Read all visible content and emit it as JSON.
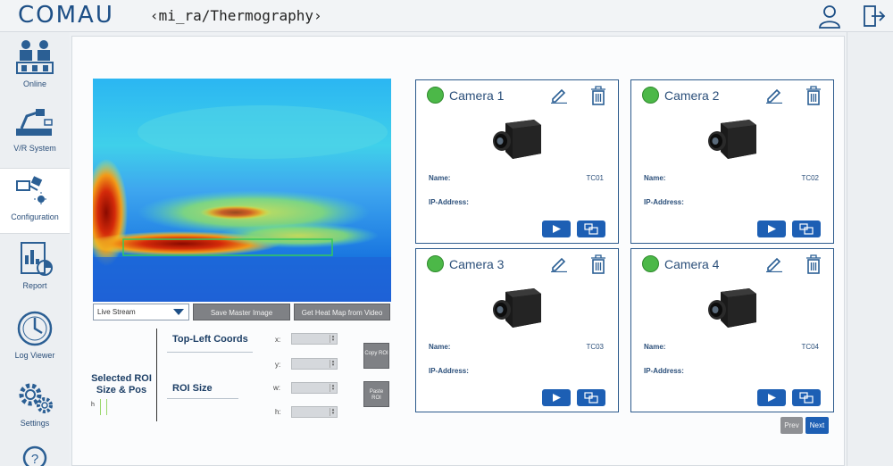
{
  "header": {
    "brand": "COMAU",
    "title": "‹mi_ra/Thermography›",
    "icons": [
      "user-icon",
      "logout-icon"
    ]
  },
  "sidebar": {
    "items": [
      {
        "label": "Online",
        "icon": "online-icon",
        "active": false
      },
      {
        "label": "V/R System",
        "icon": "robot-icon",
        "active": false
      },
      {
        "label": "Configuration",
        "icon": "configuration-icon",
        "active": true
      },
      {
        "label": "Report",
        "icon": "report-icon",
        "active": false
      },
      {
        "label": "Log Viewer",
        "icon": "clock-icon",
        "active": false
      },
      {
        "label": "Settings",
        "icon": "gear-icon",
        "active": false
      },
      {
        "label": "",
        "icon": "help-icon",
        "active": false
      }
    ]
  },
  "viewer": {
    "stream_select": "Live Stream",
    "save_master": "Save Master Image",
    "get_heatmap": "Get Heat Map from Video"
  },
  "roi": {
    "title": "Selected ROI Size & Pos",
    "top_left_label": "Top-Left Coords",
    "size_label": "ROI Size",
    "fields": {
      "x": "x:",
      "y": "y:",
      "w": "w:",
      "h": "h:"
    },
    "copy_btn": "Copy ROI",
    "paste_btn": "Paste ROI",
    "indicator": "h"
  },
  "cameras": [
    {
      "name": "Camera 1",
      "name_label": "Name:",
      "ip_label": "IP-Address:",
      "id": "TC01",
      "status": "online"
    },
    {
      "name": "Camera 2",
      "name_label": "Name:",
      "ip_label": "IP-Address:",
      "id": "TC02",
      "status": "online"
    },
    {
      "name": "Camera 3",
      "name_label": "Name:",
      "ip_label": "IP-Address:",
      "id": "TC03",
      "status": "online"
    },
    {
      "name": "Camera 4",
      "name_label": "Name:",
      "ip_label": "IP-Address:",
      "id": "TC04",
      "status": "online"
    }
  ],
  "pager": {
    "prev": "Prev",
    "next": "Next"
  },
  "colors": {
    "brand": "#1d4f86",
    "status_online": "#4cb848",
    "action_button": "#1d5fb4",
    "disabled_button": "#7f8185"
  }
}
